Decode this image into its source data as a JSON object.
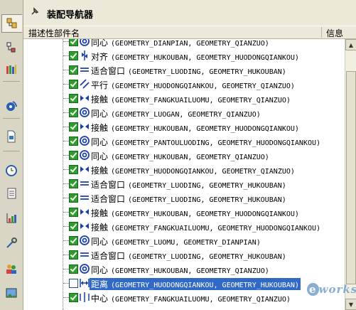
{
  "window": {
    "title": "装配导航器",
    "columns": {
      "description": "描述性部件名",
      "info": "信息"
    }
  },
  "colors": {
    "selection": "#3169c6",
    "checkbox_checked": "#2a9d2a",
    "constraint_icon": "#1a3fa6",
    "panel_bg": "#ece9d8"
  },
  "toolbar_icons": [
    "assembly-navigator-icon",
    "part-navigator-icon",
    "reuse-library-icon",
    "history-icon",
    "document-icon",
    "clock-icon",
    "list-icon",
    "analysis-icon",
    "tools-icon",
    "roles-icon",
    "image-icon"
  ],
  "constraints": [
    {
      "type": "同心",
      "icon": "concentric-icon",
      "detail": "(GEOMETRY_DIANPIAN, GEOMETRY_QIANZUO)",
      "checked": true,
      "selected": false
    },
    {
      "type": "对齐",
      "icon": "align-icon",
      "detail": "(GEOMETRY_HUKOUBAN, GEOMETRY_HUODONGQIANKOU)",
      "checked": true,
      "selected": false
    },
    {
      "type": "适合窗口",
      "icon": "fit-icon",
      "detail": "(GEOMETRY_LUODING, GEOMETRY_HUKOUBAN)",
      "checked": true,
      "selected": false
    },
    {
      "type": "平行",
      "icon": "parallel-icon",
      "detail": "(GEOMETRY_HUODONGQIANKOU, GEOMETRY_QIANZUO)",
      "checked": true,
      "selected": false
    },
    {
      "type": "接触",
      "icon": "touch-icon",
      "detail": "(GEOMETRY_FANGKUAILUOMU, GEOMETRY_QIANZUO)",
      "checked": true,
      "selected": false
    },
    {
      "type": "同心",
      "icon": "concentric-icon",
      "detail": "(GEOMETRY_LUOGAN, GEOMETRY_QIANZUO)",
      "checked": true,
      "selected": false
    },
    {
      "type": "接触",
      "icon": "touch-icon",
      "detail": "(GEOMETRY_HUKOUBAN, GEOMETRY_HUODONGQIANKOU)",
      "checked": true,
      "selected": false
    },
    {
      "type": "同心",
      "icon": "concentric-icon",
      "detail": "(GEOMETRY_PANTOULUODING, GEOMETRY_HUODONGQIANKOU)",
      "checked": true,
      "selected": false
    },
    {
      "type": "同心",
      "icon": "concentric-icon",
      "detail": "(GEOMETRY_HUKOUBAN, GEOMETRY_QIANZUO)",
      "checked": true,
      "selected": false
    },
    {
      "type": "接触",
      "icon": "touch-icon",
      "detail": "(GEOMETRY_HUODONGQIANKOU, GEOMETRY_QIANZUO)",
      "checked": true,
      "selected": false
    },
    {
      "type": "适合窗口",
      "icon": "fit-icon",
      "detail": "(GEOMETRY_LUODING, GEOMETRY_HUKOUBAN)",
      "checked": true,
      "selected": false
    },
    {
      "type": "适合窗口",
      "icon": "fit-icon",
      "detail": "(GEOMETRY_LUODING, GEOMETRY_HUKOUBAN)",
      "checked": true,
      "selected": false
    },
    {
      "type": "接触",
      "icon": "touch-icon",
      "detail": "(GEOMETRY_HUKOUBAN, GEOMETRY_HUODONGQIANKOU)",
      "checked": true,
      "selected": false
    },
    {
      "type": "接触",
      "icon": "touch-icon",
      "detail": "(GEOMETRY_FANGKUAILUOMU, GEOMETRY_HUODONGQIANKOU)",
      "checked": true,
      "selected": false
    },
    {
      "type": "同心",
      "icon": "concentric-icon",
      "detail": "(GEOMETRY_LUOMU, GEOMETRY_DIANPIAN)",
      "checked": true,
      "selected": false
    },
    {
      "type": "适合窗口",
      "icon": "fit-icon",
      "detail": "(GEOMETRY_LUODING, GEOMETRY_HUKOUBAN)",
      "checked": true,
      "selected": false
    },
    {
      "type": "同心",
      "icon": "concentric-icon",
      "detail": "(GEOMETRY_HUKOUBAN, GEOMETRY_QIANZUO)",
      "checked": true,
      "selected": false
    },
    {
      "type": "距离",
      "icon": "distance-icon",
      "detail": "(GEOMETRY_HUODONGQIANKOU, GEOMETRY_HUKOUBAN)",
      "checked": false,
      "selected": true
    },
    {
      "type": "中心",
      "icon": "center-icon",
      "detail": "(GEOMETRY_FANGKUAILUOMU, GEOMETRY_QIANZUO)",
      "checked": true,
      "selected": false
    }
  ],
  "watermark": {
    "prefix": "e",
    "text": "works"
  }
}
